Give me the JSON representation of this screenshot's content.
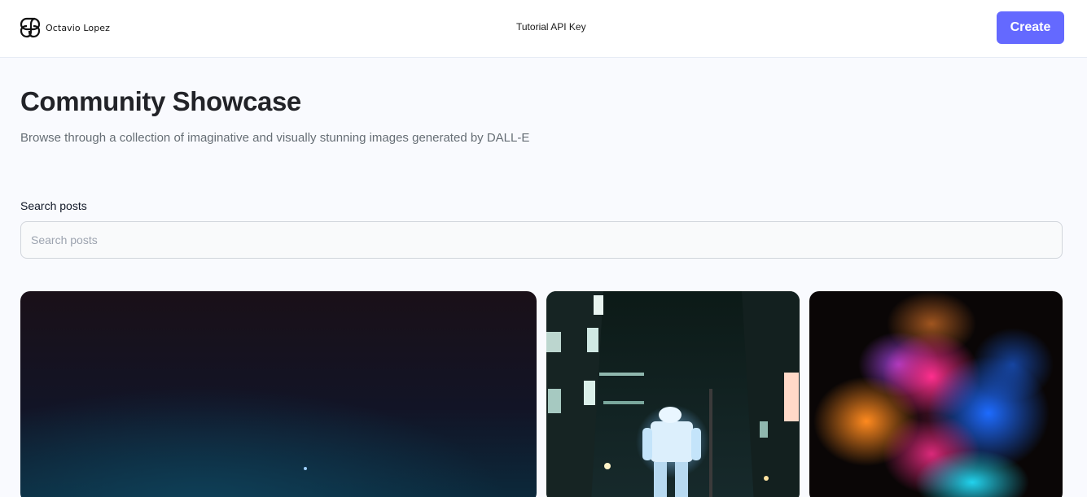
{
  "header": {
    "brand_name": "Octavio Lopez",
    "brand_icon": "knot-logo-icon",
    "tutorial_link": "Tutorial API Key",
    "create_label": "Create",
    "accent_color": "#6469ff"
  },
  "main": {
    "title": "Community Showcase",
    "subtitle": "Browse through a collection of imaginative and visually stunning images generated by DALL-E",
    "search": {
      "label": "Search posts",
      "placeholder": "Search posts",
      "value": ""
    },
    "posts": [
      {
        "image": "dark-night-sky-image"
      },
      {
        "image": "neon-robot-city-image"
      },
      {
        "image": "color-powder-explosion-image"
      }
    ]
  }
}
